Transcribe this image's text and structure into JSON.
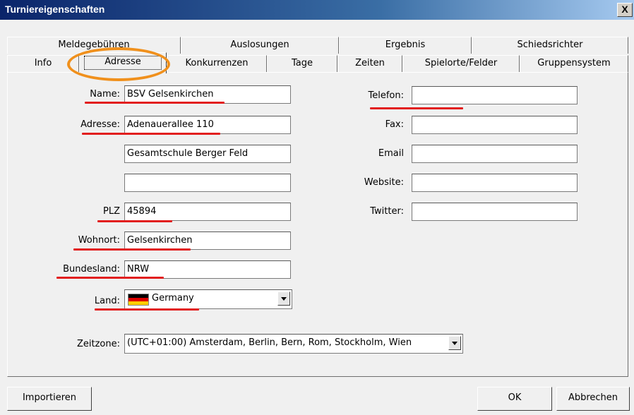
{
  "window": {
    "title": "Turniereigenschaften",
    "close": "X"
  },
  "tabs_back": [
    {
      "label": "Meldegebühren"
    },
    {
      "label": "Auslosungen"
    },
    {
      "label": "Ergebnis"
    },
    {
      "label": "Schiedsrichter"
    }
  ],
  "tabs_front": [
    {
      "label": "Info"
    },
    {
      "label": "Adresse"
    },
    {
      "label": "Konkurrenzen"
    },
    {
      "label": "Tage"
    },
    {
      "label": "Zeiten"
    },
    {
      "label": "Spielorte/Felder"
    },
    {
      "label": "Gruppensystem"
    }
  ],
  "address": {
    "name_label": "Name:",
    "name": "BSV Gelsenkirchen",
    "address_label": "Adresse:",
    "address1": "Adenauerallee 110",
    "address2": "Gesamtschule Berger Feld",
    "address3": "",
    "plz_label": "PLZ",
    "plz": "45894",
    "city_label": "Wohnort:",
    "city": "Gelsenkirchen",
    "state_label": "Bundesland:",
    "state": "NRW",
    "country_label": "Land:",
    "country": "Germany"
  },
  "contact": {
    "phone_label": "Telefon:",
    "phone": "",
    "fax_label": "Fax:",
    "fax": "",
    "email_label": "Email",
    "email": "",
    "website_label": "Website:",
    "website": "",
    "twitter_label": "Twitter:",
    "twitter": ""
  },
  "timezone": {
    "label": "Zeitzone:",
    "value": "(UTC+01:00) Amsterdam, Berlin, Bern, Rom, Stockholm, Wien"
  },
  "buttons": {
    "import": "Importieren",
    "ok": "OK",
    "cancel": "Abbrechen"
  },
  "colors": {
    "annotation_underline": "#e21f1f",
    "annotation_circle": "#f0901c",
    "titlebar": "#0a246a"
  },
  "icons": {
    "country_flag": "germany-flag-icon"
  }
}
